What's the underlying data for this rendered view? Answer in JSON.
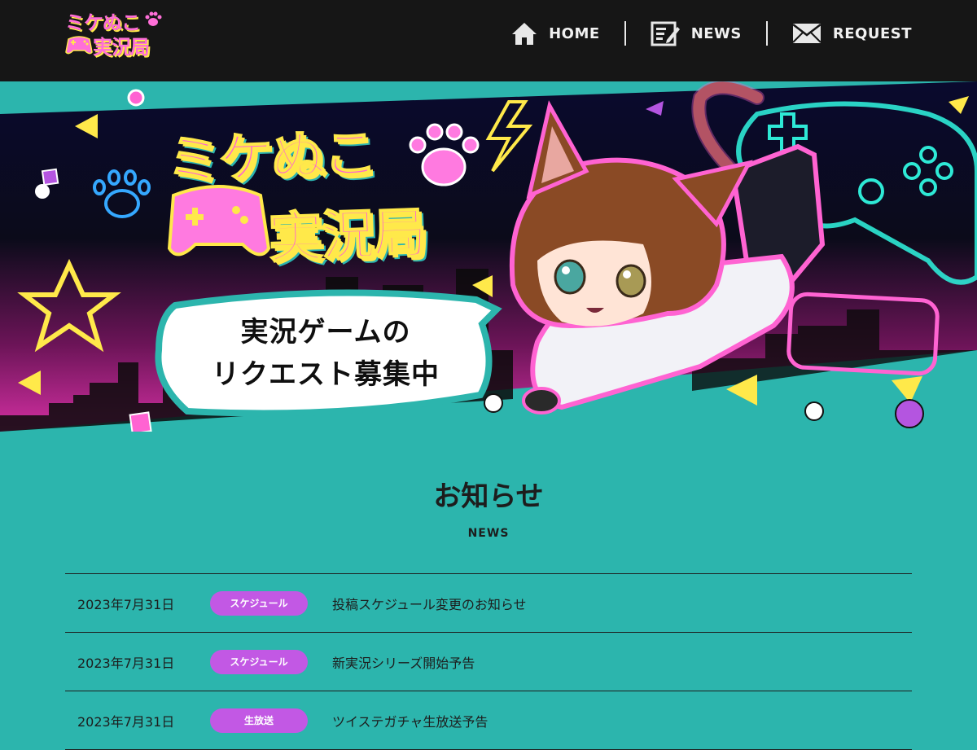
{
  "header": {
    "logo_line1": "ミケぬこ",
    "logo_line2": "実況局",
    "nav": [
      {
        "label": "HOME",
        "icon": "home-icon"
      },
      {
        "label": "NEWS",
        "icon": "news-edit-icon"
      },
      {
        "label": "REQUEST",
        "icon": "mail-icon"
      }
    ]
  },
  "hero": {
    "title_line1": "ミケぬこ",
    "title_line2": "実況局",
    "bubble_line1": "実況ゲームの",
    "bubble_line2": "リクエスト募集中"
  },
  "news": {
    "title": "お知らせ",
    "subtitle": "NEWS",
    "items": [
      {
        "date": "2023年7月31日",
        "category": "スケジュール",
        "text": "投稿スケジュール変更のお知らせ"
      },
      {
        "date": "2023年7月31日",
        "category": "スケジュール",
        "text": "新実況シリーズ開始予告"
      },
      {
        "date": "2023年7月31日",
        "category": "生放送",
        "text": "ツイステガチャ生放送予告"
      }
    ]
  },
  "colors": {
    "teal": "#2cb5ad",
    "header_bg": "#161616",
    "badge_purple": "#c258e4",
    "neon_pink": "#ff63d2",
    "neon_yellow": "#ffe94a"
  }
}
